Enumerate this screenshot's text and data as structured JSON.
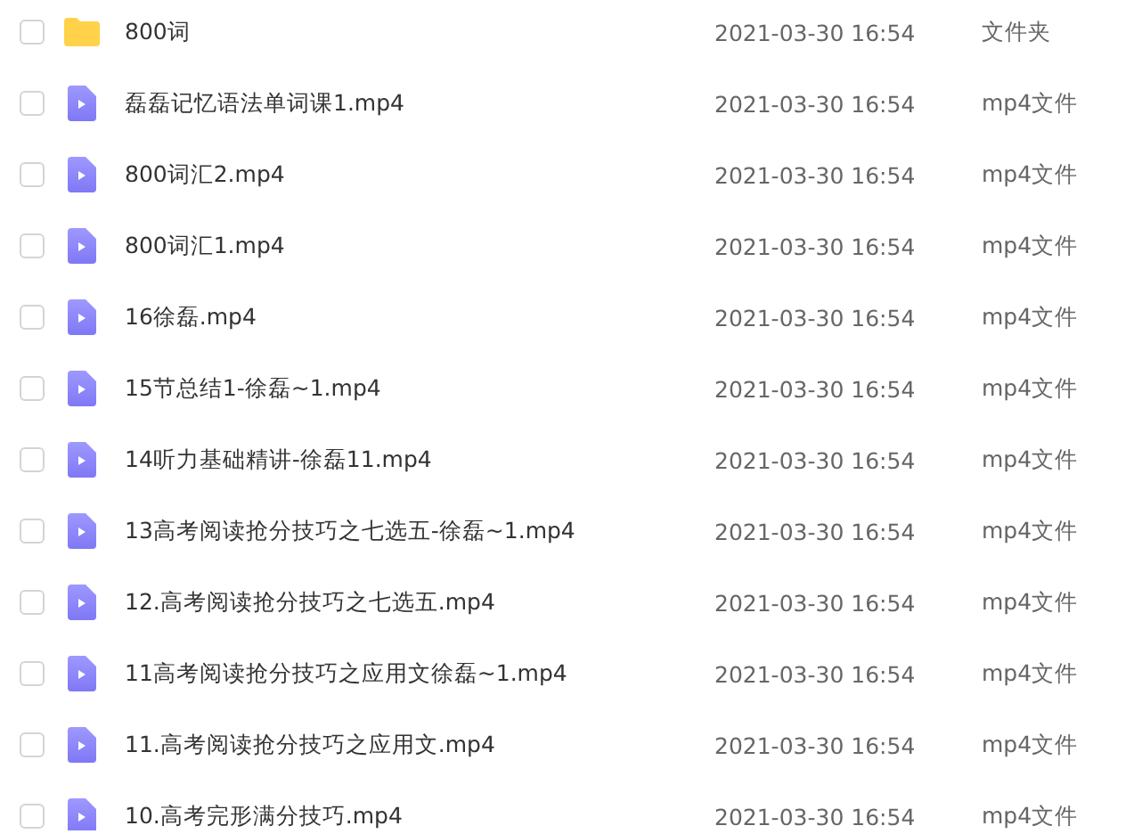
{
  "files": [
    {
      "kind": "folder",
      "name": "800词",
      "modified": "2021-03-30 16:54",
      "type": "文件夹",
      "checked": false
    },
    {
      "kind": "video",
      "name": "磊磊记忆语法单词课1.mp4",
      "modified": "2021-03-30 16:54",
      "type": "mp4文件",
      "checked": false
    },
    {
      "kind": "video",
      "name": "800词汇2.mp4",
      "modified": "2021-03-30 16:54",
      "type": "mp4文件",
      "checked": false
    },
    {
      "kind": "video",
      "name": "800词汇1.mp4",
      "modified": "2021-03-30 16:54",
      "type": "mp4文件",
      "checked": false
    },
    {
      "kind": "video",
      "name": "16徐磊.mp4",
      "modified": "2021-03-30 16:54",
      "type": "mp4文件",
      "checked": false
    },
    {
      "kind": "video",
      "name": "15节总结1-徐磊~1.mp4",
      "modified": "2021-03-30 16:54",
      "type": "mp4文件",
      "checked": false
    },
    {
      "kind": "video",
      "name": "14听力基础精讲-徐磊11.mp4",
      "modified": "2021-03-30 16:54",
      "type": "mp4文件",
      "checked": false
    },
    {
      "kind": "video",
      "name": "13高考阅读抢分技巧之七选五-徐磊~1.mp4",
      "modified": "2021-03-30 16:54",
      "type": "mp4文件",
      "checked": false
    },
    {
      "kind": "video",
      "name": "12.高考阅读抢分技巧之七选五.mp4",
      "modified": "2021-03-30 16:54",
      "type": "mp4文件",
      "checked": false
    },
    {
      "kind": "video",
      "name": "11高考阅读抢分技巧之应用文徐磊~1.mp4",
      "modified": "2021-03-30 16:54",
      "type": "mp4文件",
      "checked": false
    },
    {
      "kind": "video",
      "name": "11.高考阅读抢分技巧之应用文.mp4",
      "modified": "2021-03-30 16:54",
      "type": "mp4文件",
      "checked": false
    },
    {
      "kind": "video",
      "name": "10.高考完形满分技巧.mp4",
      "modified": "2021-03-30 16:54",
      "type": "mp4文件",
      "checked": false
    }
  ]
}
